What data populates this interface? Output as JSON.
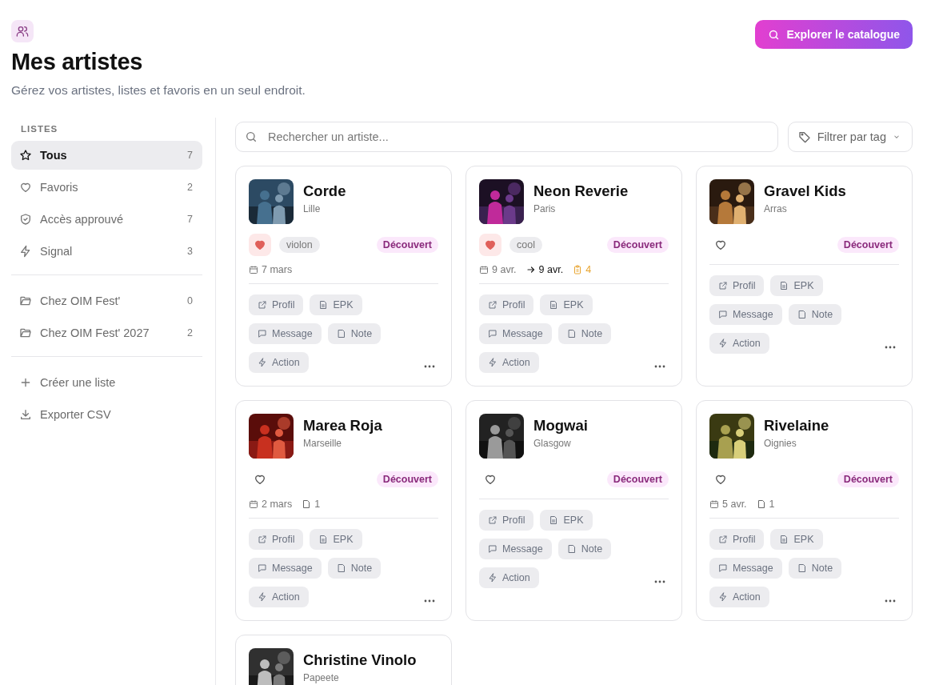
{
  "header": {
    "title": "Mes artistes",
    "subtitle": "Gérez vos artistes, listes et favoris en un seul endroit.",
    "cta": "Explorer le catalogue"
  },
  "sidebar": {
    "heading": "LISTES",
    "lists": [
      {
        "label": "Tous",
        "count": "7",
        "selected": true
      },
      {
        "label": "Favoris",
        "count": "2",
        "selected": false
      },
      {
        "label": "Accès approuvé",
        "count": "7",
        "selected": false
      },
      {
        "label": "Signal",
        "count": "3",
        "selected": false
      }
    ],
    "folders": [
      {
        "label": "Chez OIM Fest'",
        "count": "0",
        "selected": false
      },
      {
        "label": "Chez OIM Fest' 2027",
        "count": "2",
        "selected": false
      }
    ],
    "actions": [
      {
        "label": "Créer une liste"
      },
      {
        "label": "Exporter CSV"
      }
    ]
  },
  "toolbar": {
    "search": {
      "placeholder": "Rechercher un artiste..."
    },
    "filter": "Filtrer par tag"
  },
  "cards": [
    {
      "name": "Corde",
      "city": "Lille",
      "favorite": true,
      "tag": "violon",
      "status": "Découvert",
      "meta": [
        {
          "kind": "date",
          "text": "7 mars"
        }
      ],
      "actions": [
        {
          "kind": "profile",
          "label": "Profil"
        },
        {
          "kind": "epk",
          "label": "EPK"
        },
        {
          "kind": "message",
          "label": "Message"
        },
        {
          "kind": "note",
          "label": "Note"
        },
        {
          "kind": "action",
          "label": "Action"
        }
      ]
    },
    {
      "name": "Neon Reverie",
      "city": "Paris",
      "favorite": true,
      "tag": "cool",
      "status": "Découvert",
      "meta": [
        {
          "kind": "date",
          "text": "9 avr."
        },
        {
          "kind": "next",
          "text": "9 avr."
        },
        {
          "kind": "task",
          "text": "4"
        }
      ],
      "actions": [
        {
          "kind": "profile",
          "label": "Profil"
        },
        {
          "kind": "epk",
          "label": "EPK"
        },
        {
          "kind": "message",
          "label": "Message"
        },
        {
          "kind": "note",
          "label": "Note"
        },
        {
          "kind": "action",
          "label": "Action"
        }
      ]
    },
    {
      "name": "Gravel Kids",
      "city": "Arras",
      "favorite": false,
      "status": "Découvert",
      "actions": [
        {
          "kind": "profile",
          "label": "Profil"
        },
        {
          "kind": "epk",
          "label": "EPK"
        },
        {
          "kind": "message",
          "label": "Message"
        },
        {
          "kind": "note",
          "label": "Note"
        },
        {
          "kind": "action",
          "label": "Action"
        }
      ]
    },
    {
      "name": "Marea Roja",
      "city": "Marseille",
      "favorite": false,
      "status": "Découvert",
      "meta": [
        {
          "kind": "date",
          "text": "2 mars"
        },
        {
          "kind": "note",
          "text": "1"
        }
      ],
      "actions": [
        {
          "kind": "profile",
          "label": "Profil"
        },
        {
          "kind": "epk",
          "label": "EPK"
        },
        {
          "kind": "message",
          "label": "Message"
        },
        {
          "kind": "note",
          "label": "Note"
        },
        {
          "kind": "action",
          "label": "Action"
        }
      ]
    },
    {
      "name": "Mogwai",
      "city": "Glasgow",
      "favorite": false,
      "status": "Découvert",
      "actions": [
        {
          "kind": "profile",
          "label": "Profil"
        },
        {
          "kind": "epk",
          "label": "EPK"
        },
        {
          "kind": "message",
          "label": "Message"
        },
        {
          "kind": "note",
          "label": "Note"
        },
        {
          "kind": "action",
          "label": "Action"
        }
      ]
    },
    {
      "name": "Rivelaine",
      "city": "Oignies",
      "favorite": false,
      "status": "Découvert",
      "meta": [
        {
          "kind": "date",
          "text": "5 avr."
        },
        {
          "kind": "note",
          "text": "1"
        }
      ],
      "actions": [
        {
          "kind": "profile",
          "label": "Profil"
        },
        {
          "kind": "epk",
          "label": "EPK"
        },
        {
          "kind": "message",
          "label": "Message"
        },
        {
          "kind": "note",
          "label": "Note"
        },
        {
          "kind": "action",
          "label": "Action"
        }
      ]
    },
    {
      "name": "Christine Vinolo",
      "city": "Papeete"
    }
  ]
}
